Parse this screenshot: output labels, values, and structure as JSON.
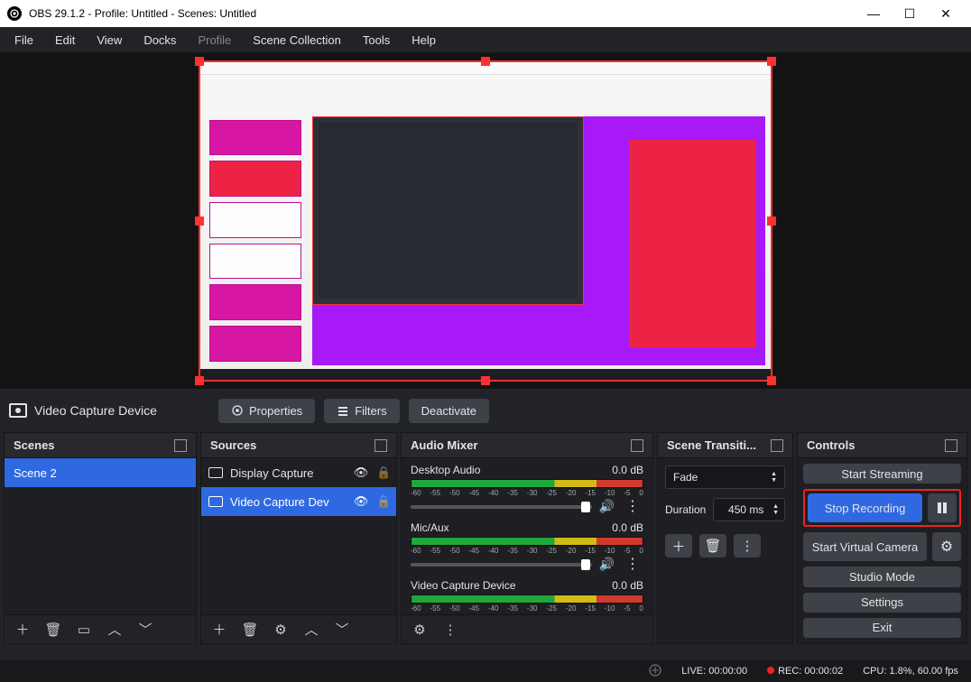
{
  "window": {
    "title": "OBS 29.1.2 - Profile: Untitled - Scenes: Untitled"
  },
  "menu": {
    "file": "File",
    "edit": "Edit",
    "view": "View",
    "docks": "Docks",
    "profile": "Profile",
    "scene_collection": "Scene Collection",
    "tools": "Tools",
    "help": "Help"
  },
  "context": {
    "source": "Video Capture Device",
    "properties": "Properties",
    "filters": "Filters",
    "deactivate": "Deactivate"
  },
  "scenes": {
    "title": "Scenes",
    "items": [
      "Scene 2"
    ]
  },
  "sources": {
    "title": "Sources",
    "items": [
      {
        "label": "Display Capture",
        "selected": false
      },
      {
        "label": "Video Capture Dev",
        "selected": true
      }
    ]
  },
  "mixer": {
    "title": "Audio Mixer",
    "channels": [
      {
        "name": "Desktop Audio",
        "db": "0.0 dB"
      },
      {
        "name": "Mic/Aux",
        "db": "0.0 dB"
      },
      {
        "name": "Video Capture Device",
        "db": "0.0 dB"
      }
    ],
    "ticks": [
      "-60",
      "-55",
      "-50",
      "-45",
      "-40",
      "-35",
      "-30",
      "-25",
      "-20",
      "-15",
      "-10",
      "-5",
      "0"
    ]
  },
  "transitions": {
    "title": "Scene Transiti...",
    "type": "Fade",
    "duration_label": "Duration",
    "duration": "450 ms"
  },
  "controls": {
    "title": "Controls",
    "start_streaming": "Start Streaming",
    "stop_recording": "Stop Recording",
    "start_virtual_camera": "Start Virtual Camera",
    "studio_mode": "Studio Mode",
    "settings": "Settings",
    "exit": "Exit"
  },
  "status": {
    "live": "LIVE: 00:00:00",
    "rec": "REC: 00:00:02",
    "cpu": "CPU: 1.8%, 60.00 fps"
  }
}
